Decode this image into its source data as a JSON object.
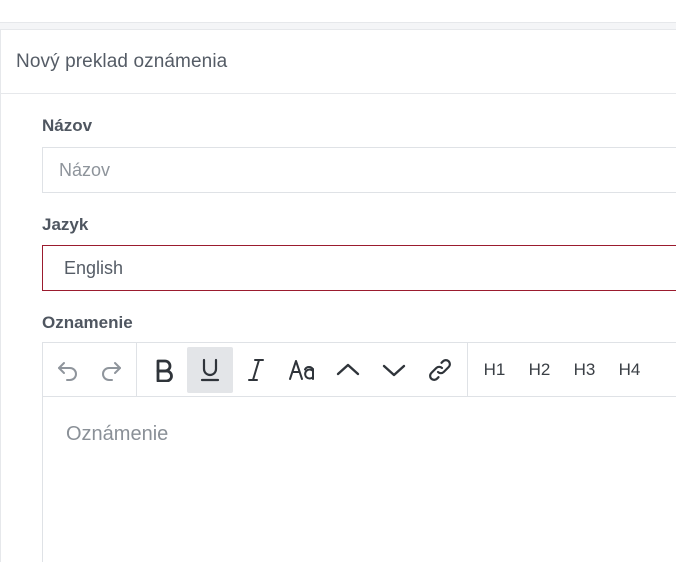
{
  "panel": {
    "title": "Nový preklad oznámenia"
  },
  "form": {
    "name": {
      "label": "Názov",
      "placeholder": "Názov",
      "value": ""
    },
    "language": {
      "label": "Jazyk",
      "selected": "English"
    },
    "announcement": {
      "label": "Oznamenie",
      "placeholder": "Oznámenie"
    }
  },
  "toolbar": {
    "undo_icon": "undo-icon",
    "redo_icon": "redo-icon",
    "bold_icon": "bold-icon",
    "underline_icon": "underline-icon",
    "italic_icon": "italic-icon",
    "font_size_icon": "font-size-icon",
    "superscript_icon": "chevron-up-icon",
    "subscript_icon": "chevron-down-icon",
    "link_icon": "link-icon",
    "headings": [
      "H1",
      "H2",
      "H3",
      "H4"
    ]
  },
  "colors": {
    "select_border": "#9b1b2e",
    "active_button_bg": "#e3e5e8",
    "border": "#dfe2e6"
  }
}
